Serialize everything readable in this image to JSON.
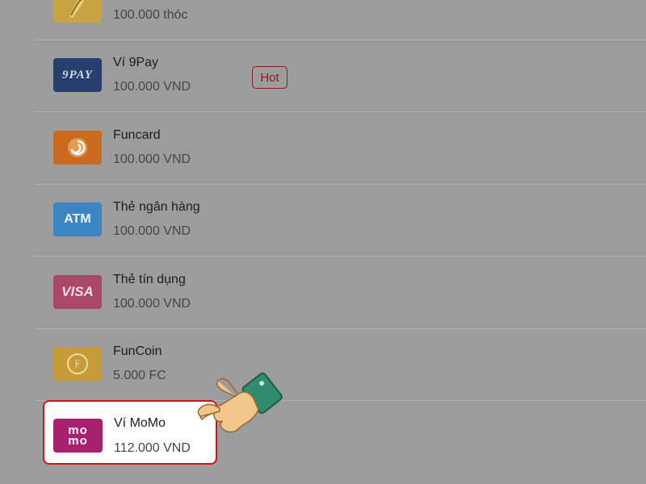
{
  "payment_methods": [
    {
      "name": "",
      "price": "100.000 thóc",
      "icon": "thoc-icon"
    },
    {
      "name": "Ví 9Pay",
      "price": "100.000 VND",
      "icon": "ninepay-icon",
      "icon_text": "9PAY",
      "badge": "Hot"
    },
    {
      "name": "Funcard",
      "price": "100.000 VND",
      "icon": "funcard-icon"
    },
    {
      "name": "Thẻ ngân hàng",
      "price": "100.000 VND",
      "icon": "atm-icon",
      "icon_text": "ATM"
    },
    {
      "name": "Thẻ tín dụng",
      "price": "100.000 VND",
      "icon": "visa-icon",
      "icon_text": "VISA"
    },
    {
      "name": "FunCoin",
      "price": "5.000 FC",
      "icon": "funcoin-icon",
      "icon_text": "F"
    }
  ],
  "selected_method": {
    "name": "Ví MoMo",
    "price": "112.000 VND",
    "icon": "momo-icon",
    "icon_text_top": "mo",
    "icon_text_bottom": "mo"
  },
  "colors": {
    "overlay_bg": "#9c9c9c",
    "highlight_border": "#d0121c",
    "badge": "#8c1a1a",
    "ninepay": "#263f6e",
    "funcard": "#c96a1e",
    "atm": "#3b86c2",
    "visa": "#aa4868",
    "funcoin": "#c69b3a",
    "momo": "#a8206e"
  }
}
